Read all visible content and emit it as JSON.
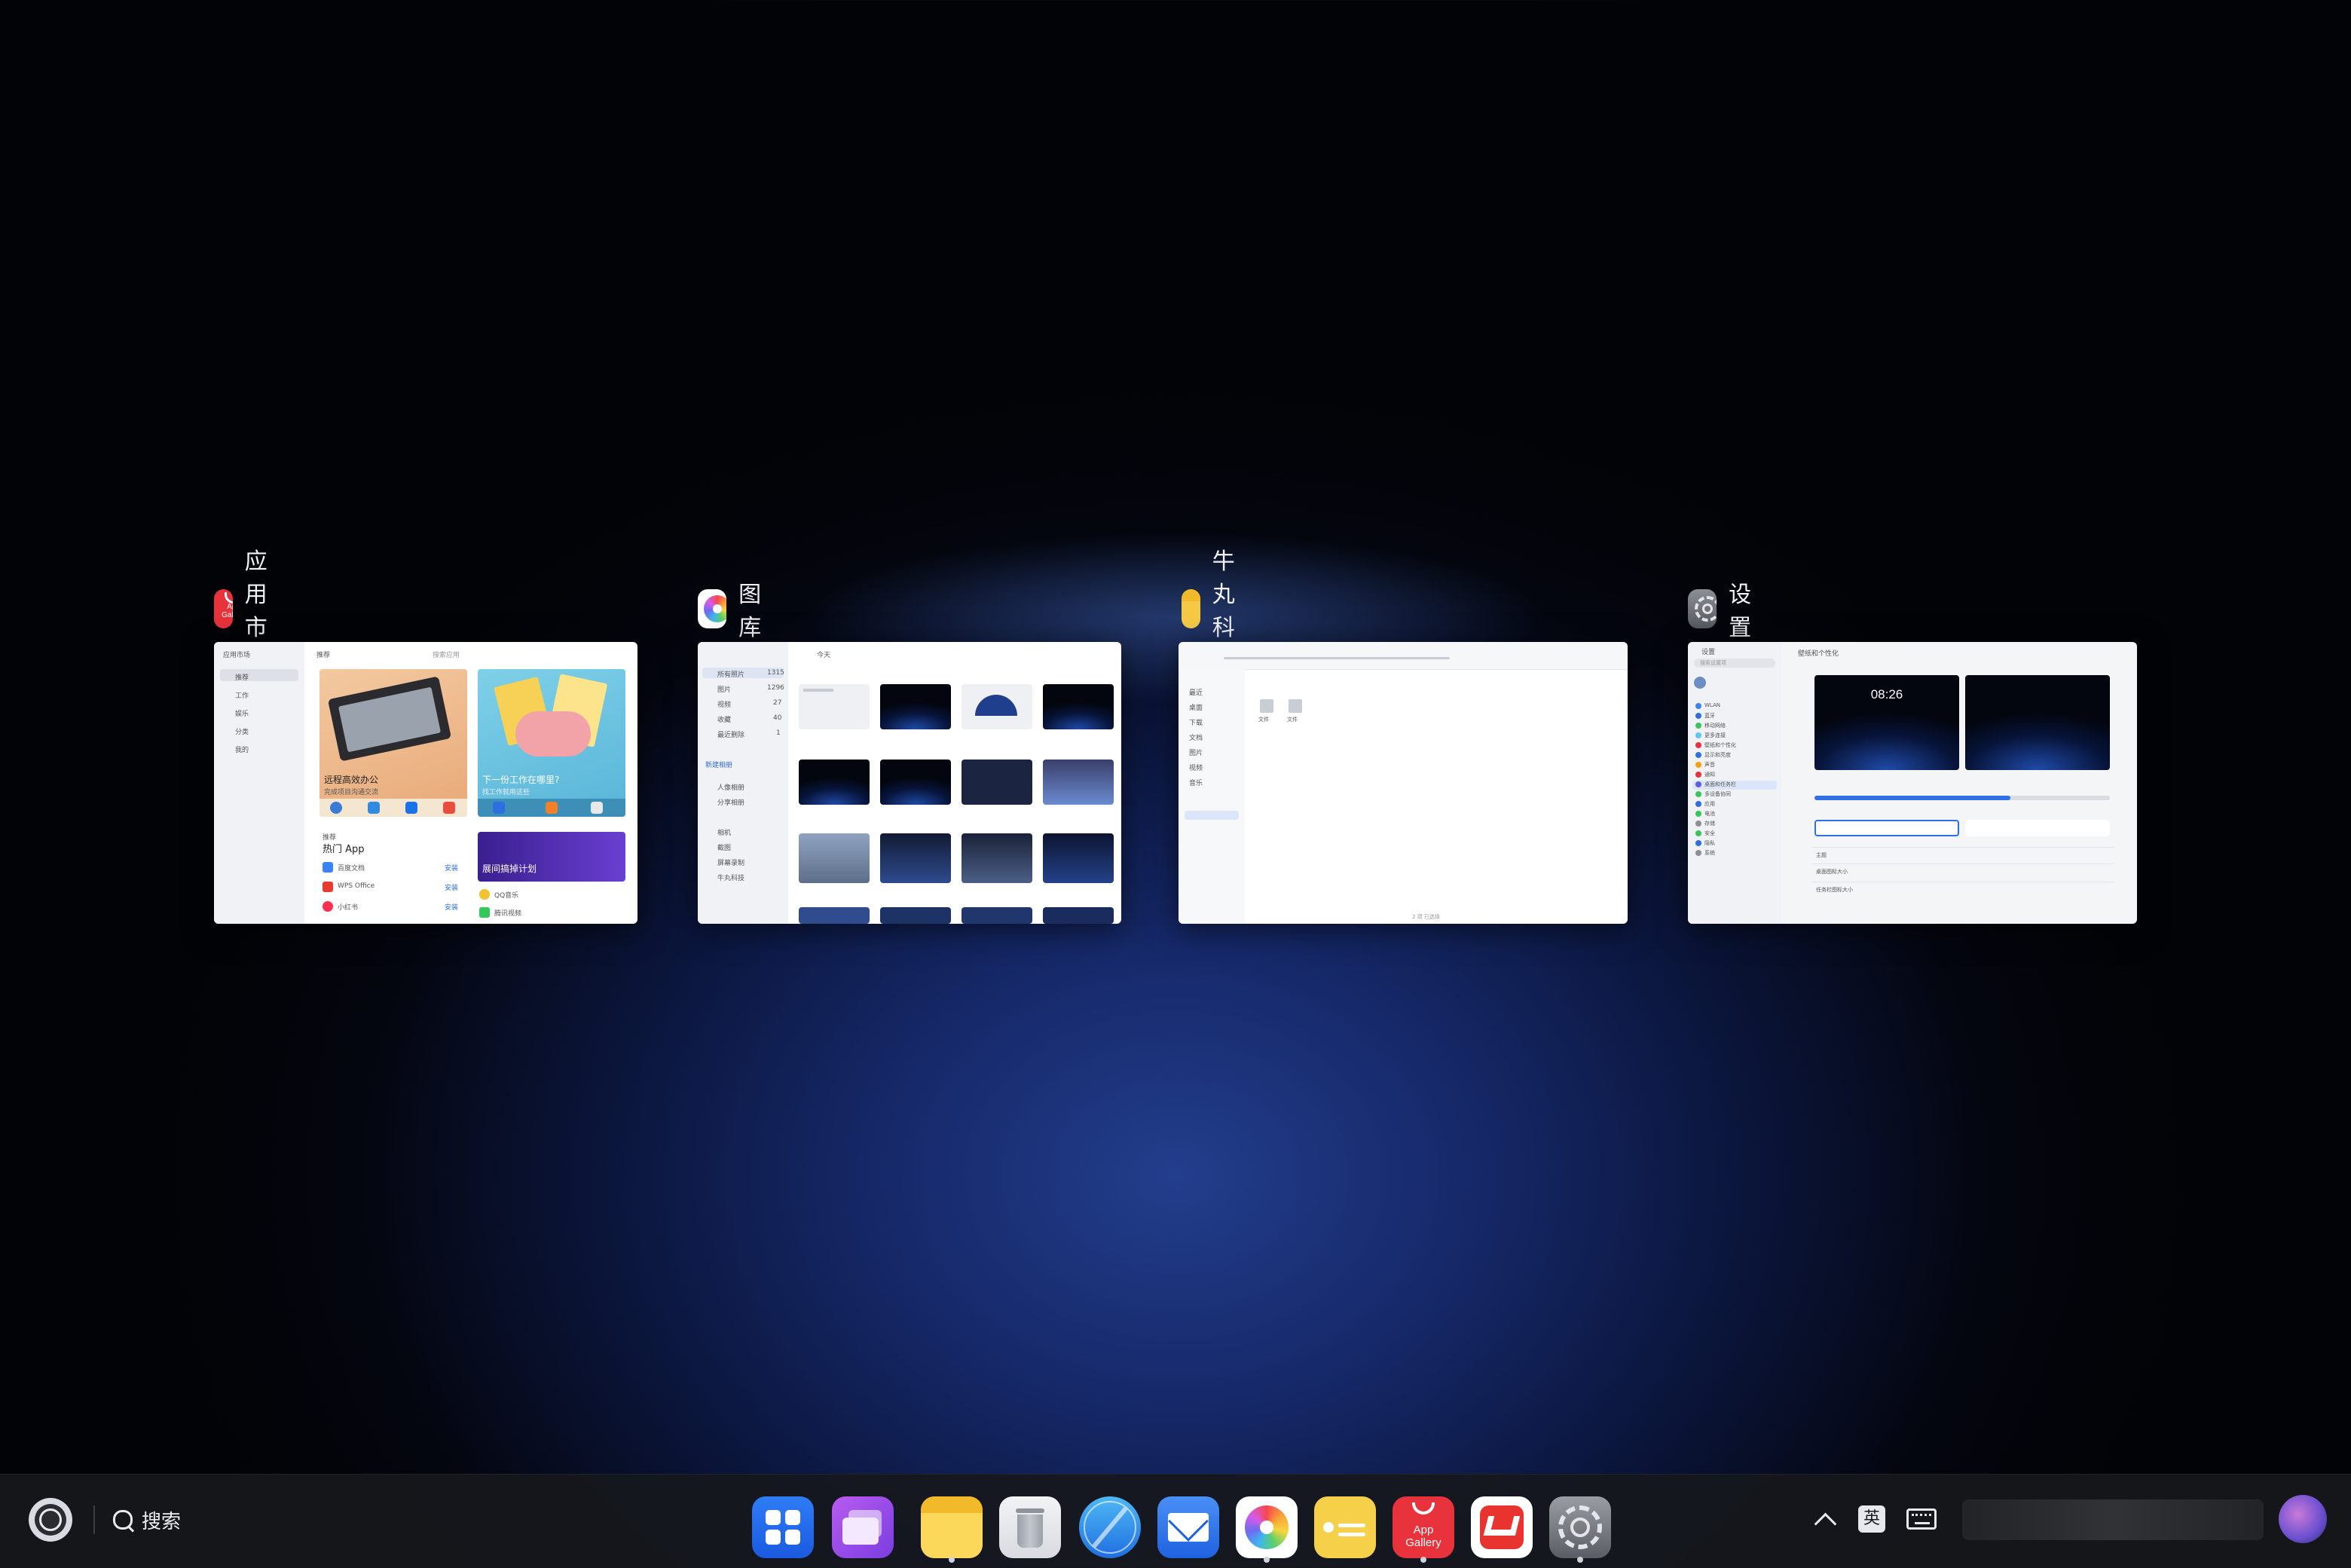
{
  "windows": [
    {
      "title": "应用市场",
      "content": {
        "sidebar_title": "应用市场",
        "nav": [
          "推荐",
          "工作",
          "娱乐",
          "分类",
          "我的"
        ],
        "header": "推荐",
        "search_placeholder": "搜索应用",
        "banner1_title": "远程高效办公",
        "banner1_sub": "完成项目沟通交流",
        "banner2_title": "下一份工作在哪里?",
        "banner2_sub": "找工作就用这些",
        "section_label": "推荐",
        "section_title": "热门 App",
        "apps": [
          "百度文档",
          "WPS Office",
          "小红书"
        ],
        "promo_title": "展间搞掉计划",
        "promo_apps": [
          "QQ音乐",
          "腾讯视频"
        ],
        "action_label": "安装"
      }
    },
    {
      "title": "图库",
      "content": {
        "sidebar_items": [
          "所有照片",
          "图片",
          "视频",
          "收藏",
          "最近删除"
        ],
        "counts": [
          "1315",
          "1296",
          "27",
          "40",
          "1"
        ],
        "header": "今天",
        "group_items": [
          "人像相册",
          "分享相册"
        ],
        "album_items": [
          "相机",
          "截图",
          "屏幕录制",
          "牛丸科技"
        ],
        "new_label": "新建相册"
      }
    },
    {
      "title": "牛丸科技",
      "content": {
        "files": [
          "文件",
          "文件"
        ],
        "sidebar_items": [
          "最近",
          "桌面",
          "下载",
          "文档",
          "图片",
          "视频",
          "音乐"
        ],
        "status": "2 项 已选择"
      }
    },
    {
      "title": "设置",
      "content": {
        "sidebar_title": "设置",
        "search_placeholder": "搜索设置项",
        "header": "壁纸和个性化",
        "clock": "08:26",
        "items": [
          "WLAN",
          "蓝牙",
          "移动网络",
          "更多连接",
          "壁纸和个性化",
          "显示和亮度",
          "声音",
          "通知",
          "桌面和任务栏",
          "多设备协同",
          "应用",
          "电池",
          "存储",
          "安全",
          "隐私",
          "系统"
        ],
        "row1": "主题",
        "row2": "桌面图标大小",
        "row3": "任务栏图标大小"
      }
    }
  ],
  "taskbar": {
    "search_label": "搜索",
    "dock": [
      {
        "name": "app-launcher",
        "running": false
      },
      {
        "name": "multitask",
        "running": false
      },
      {
        "name": "files",
        "running": true
      },
      {
        "name": "trash",
        "running": false
      },
      {
        "name": "browser",
        "running": false
      },
      {
        "name": "mail",
        "running": false
      },
      {
        "name": "gallery",
        "running": true
      },
      {
        "name": "notes",
        "running": false
      },
      {
        "name": "app-gallery",
        "running": true
      },
      {
        "name": "wps",
        "running": false
      },
      {
        "name": "settings",
        "running": true
      }
    ],
    "app_gallery_label": "App\nGallery",
    "ime_label": "英"
  },
  "colors": {
    "accent_blue": "#2e6ee6",
    "app_gallery_red": "#e8323c",
    "notes_yellow": "#f6c945",
    "taskbar_bg": "#16181c"
  }
}
